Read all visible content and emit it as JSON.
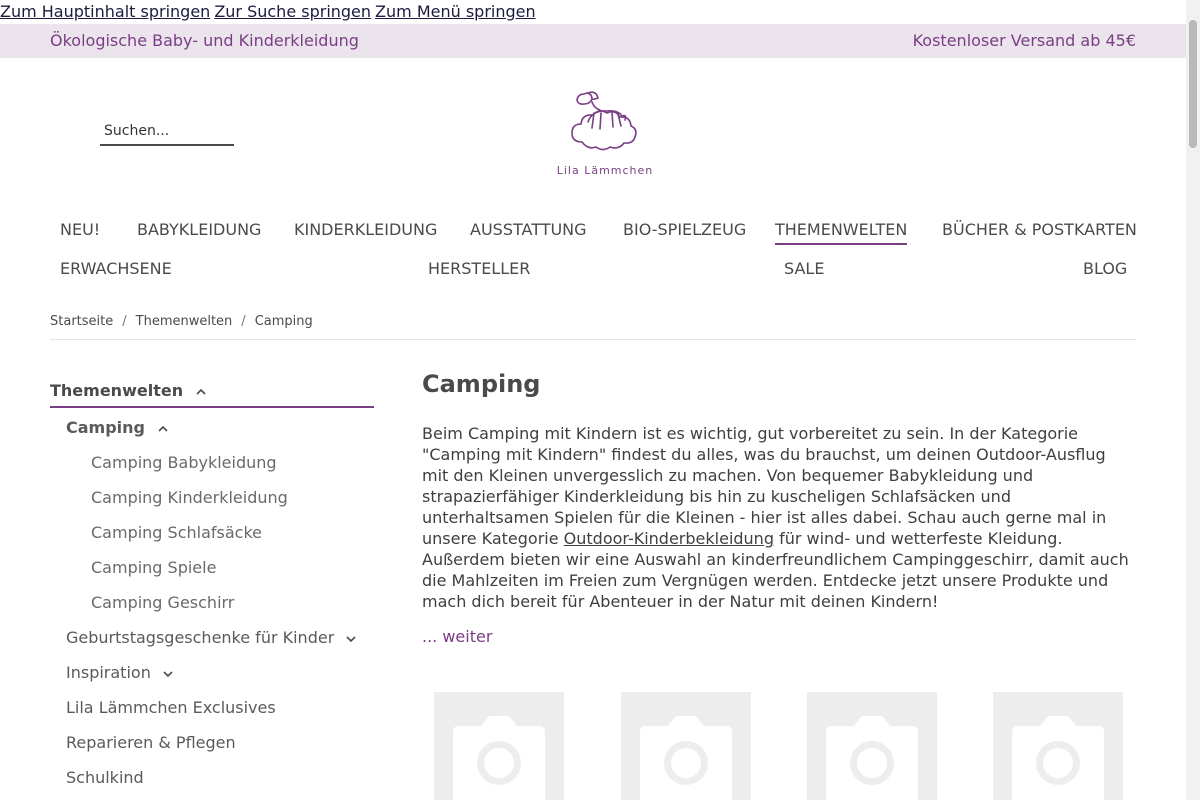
{
  "skip_links": [
    "Zum Hauptinhalt springen",
    "Zur Suche springen",
    "Zum Menü springen"
  ],
  "topbar": {
    "left": "Ökologische Baby- und Kinderkleidung",
    "right": "Kostenloser Versand ab 45€"
  },
  "search": {
    "placeholder": "Suchen..."
  },
  "logo": {
    "text": "Lila Lämmchen"
  },
  "nav": {
    "row1": [
      "NEU!",
      "BABYKLEIDUNG",
      "KINDERKLEIDUNG",
      "AUSSTATTUNG",
      "BIO-SPIELZEUG",
      "THEMENWELTEN",
      "BÜCHER & POSTKARTEN"
    ],
    "row2": [
      "ERWACHSENE",
      "HERSTELLER",
      "SALE",
      "BLOG"
    ],
    "active": "THEMENWELTEN"
  },
  "breadcrumb": [
    "Startseite",
    "Themenwelten",
    "Camping"
  ],
  "sidebar": {
    "heading": "Themenwelten",
    "current": "Camping",
    "sub_items": [
      "Camping Babykleidung",
      "Camping Kinderkleidung",
      "Camping Schlafsäcke",
      "Camping Spiele",
      "Camping Geschirr"
    ],
    "items": [
      "Geburtstagsgeschenke für Kinder",
      "Inspiration",
      "Lila Lämmchen Exclusives",
      "Reparieren & Pflegen",
      "Schulkind"
    ]
  },
  "main": {
    "title": "Camping",
    "text_part1": "Beim Camping mit Kindern ist es wichtig, gut vorbereitet zu sein. In der Kategorie \"Camping mit Kindern\" findest du alles, was du brauchst, um deinen Outdoor-Ausflug mit den Kleinen unvergesslich zu machen. Von bequemer Babykleidung und strapazierfähiger Kinderkleidung bis hin zu kuscheligen Schlafsäcken und unterhaltsamen Spielen für die Kleinen - hier ist alles dabei. Schau auch gerne mal in unsere Kategorie ",
    "text_link": "Outdoor-Kinderbekleidung",
    "text_part2": " für wind- und wetterfeste Kleidung. Außerdem bieten wir eine Auswahl an kinderfreundlichem Campinggeschirr, damit auch die Mahlzeiten im Freien zum Vergnügen werden. Entdecke jetzt unsere Produkte und mach dich bereit für Abenteuer in der Natur mit deinen Kindern!",
    "more": "... weiter"
  },
  "colors": {
    "accent": "#7a3e85",
    "topbar_bg": "#ece4ec",
    "placeholder_bg": "#ededed"
  },
  "icons": {
    "product_placeholder": "camera-icon",
    "expand": "chevron-icon"
  }
}
